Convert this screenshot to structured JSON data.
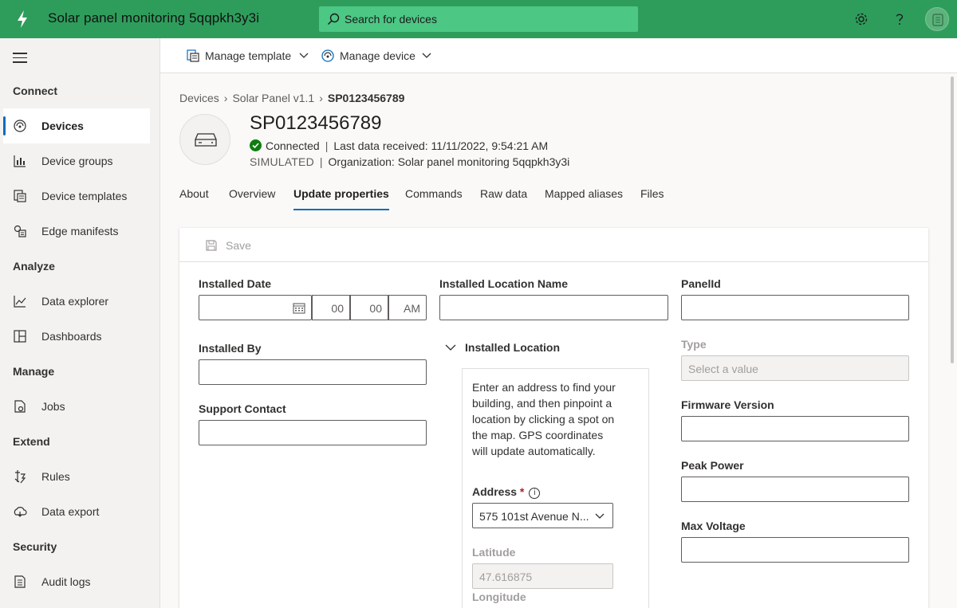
{
  "header": {
    "app_title": "Solar panel monitoring 5qqpkh3y3i",
    "search_placeholder": "Search for devices",
    "colors": {
      "brand": "#2e9d5c",
      "search_bg": "#4cc784",
      "accent": "#0f6cbd",
      "connected": "#107c10"
    }
  },
  "sidebar": {
    "sections": {
      "connect": "Connect",
      "analyze": "Analyze",
      "manage": "Manage",
      "extend": "Extend",
      "security": "Security"
    },
    "items": [
      {
        "label": "Devices",
        "icon": "devices-icon",
        "active": true
      },
      {
        "label": "Device groups",
        "icon": "device-groups-icon"
      },
      {
        "label": "Device templates",
        "icon": "device-templates-icon"
      },
      {
        "label": "Edge manifests",
        "icon": "edge-manifests-icon"
      },
      {
        "label": "Data explorer",
        "icon": "data-explorer-icon"
      },
      {
        "label": "Dashboards",
        "icon": "dashboards-icon"
      },
      {
        "label": "Jobs",
        "icon": "jobs-icon"
      },
      {
        "label": "Rules",
        "icon": "rules-icon"
      },
      {
        "label": "Data export",
        "icon": "data-export-icon"
      },
      {
        "label": "Audit logs",
        "icon": "audit-logs-icon"
      }
    ]
  },
  "commandbar": {
    "manage_template": "Manage template",
    "manage_device": "Manage device"
  },
  "breadcrumb": {
    "items": [
      "Devices",
      "Solar Panel v1.1",
      "SP0123456789"
    ]
  },
  "device": {
    "name": "SP0123456789",
    "status": "Connected",
    "last_data": "Last data received: 11/11/2022, 9:54:21 AM",
    "simulated": "SIMULATED",
    "organization": "Organization: Solar panel monitoring 5qqpkh3y3i"
  },
  "tabs": [
    "About",
    "Overview",
    "Update properties",
    "Commands",
    "Raw data",
    "Mapped aliases",
    "Files"
  ],
  "active_tab": "Update properties",
  "form": {
    "save_label": "Save",
    "installed_date": {
      "label": "Installed Date",
      "hour": "00",
      "minute": "00",
      "ampm": "AM"
    },
    "installed_by": {
      "label": "Installed By"
    },
    "support_contact": {
      "label": "Support Contact"
    },
    "installed_location_name": {
      "label": "Installed Location Name"
    },
    "installed_location": {
      "label": "Installed Location",
      "help": "Enter an address to find your building, and then pinpoint a location by clicking a spot on the map. GPS coordinates will update automatically.",
      "address_label": "Address",
      "address_required": "*",
      "address_info": "i",
      "address_value": "575 101st Avenue N...",
      "latitude_label": "Latitude",
      "latitude_value": "47.616875",
      "longitude_label": "Longitude"
    },
    "panel_id": {
      "label": "PanelId"
    },
    "type": {
      "label": "Type",
      "placeholder": "Select a value"
    },
    "firmware_version": {
      "label": "Firmware Version"
    },
    "peak_power": {
      "label": "Peak Power"
    },
    "max_voltage": {
      "label": "Max Voltage"
    }
  }
}
